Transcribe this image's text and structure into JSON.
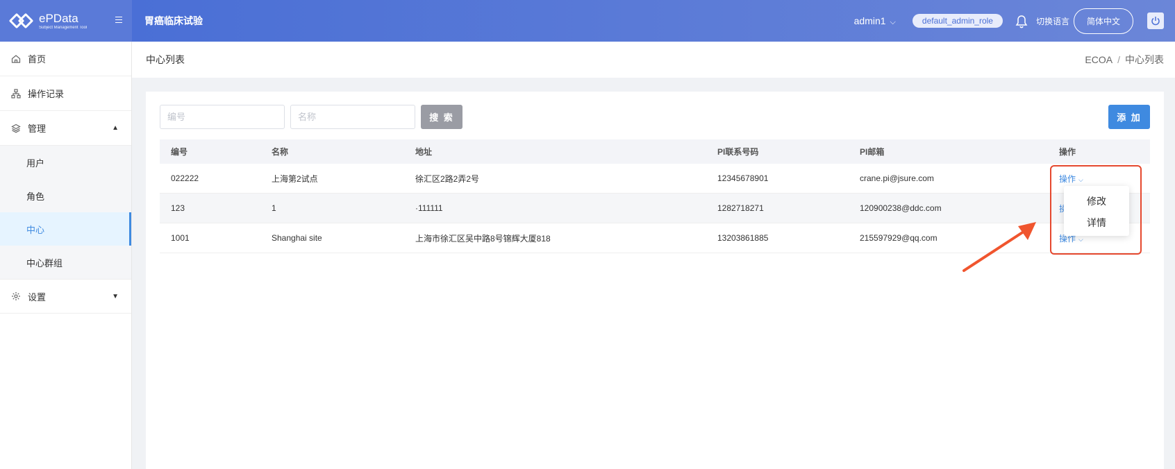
{
  "header": {
    "logo_name": "ePData",
    "logo_tagline": "Subject Management Tool",
    "trial_title": "胃癌临床试验",
    "user_name": "admin1",
    "role_badge": "default_admin_role",
    "switch_language_label": "切换语言",
    "language_button": "简体中文"
  },
  "sidebar": {
    "items": [
      {
        "label": "首页",
        "icon": "home-icon"
      },
      {
        "label": "操作记录",
        "icon": "sitemap-icon"
      },
      {
        "label": "管理",
        "icon": "layers-icon",
        "expanded": true
      },
      {
        "label": "设置",
        "icon": "gear-icon",
        "expanded": false
      }
    ],
    "management_sub": [
      {
        "label": "用户"
      },
      {
        "label": "角色"
      },
      {
        "label": "中心",
        "active": true
      },
      {
        "label": "中心群组"
      }
    ]
  },
  "page": {
    "title": "中心列表",
    "breadcrumb": [
      "ECOA",
      "中心列表"
    ]
  },
  "toolbar": {
    "code_placeholder": "编号",
    "name_placeholder": "名称",
    "search_label": "搜 索",
    "add_label": "添 加"
  },
  "table": {
    "headers": [
      "编号",
      "名称",
      "地址",
      "PI联系号码",
      "PI邮箱",
      "操作"
    ],
    "rows": [
      {
        "code": "022222",
        "name": "上海第2试点",
        "address": "徐汇区2路2弄2号",
        "phone": "12345678901",
        "email": "crane.pi@jsure.com",
        "action": "操作"
      },
      {
        "code": "123",
        "name": "1",
        "address": "·111111",
        "phone": "1282718271",
        "email": "120900238@ddc.com",
        "action": "操作"
      },
      {
        "code": "1001",
        "name": "Shanghai site",
        "address": "上海市徐汇区吴中路8号锦辉大厦818",
        "phone": "13203861885",
        "email": "215597929@qq.com",
        "action": "操作"
      }
    ]
  },
  "dropdown": {
    "items": [
      "修改",
      "详情"
    ]
  },
  "colors": {
    "primary": "#3f8ae0",
    "header_blue": "#4a6fd6",
    "annotation_red": "#e5482e"
  }
}
